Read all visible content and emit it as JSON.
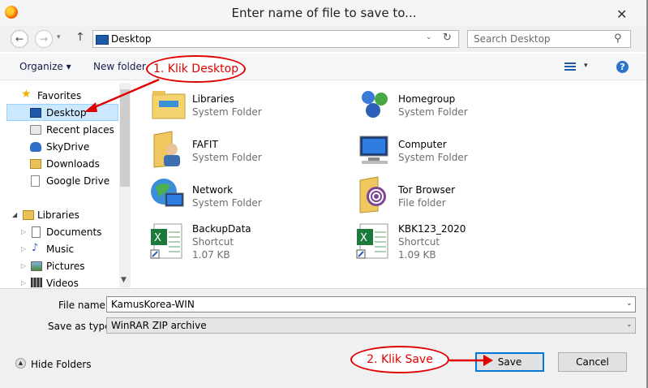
{
  "window": {
    "title": "Enter name of file to save to...",
    "close_glyph": "✕"
  },
  "nav": {
    "back_glyph": "←",
    "forward_glyph": "→",
    "up_glyph": "↑",
    "recent_glyph": "▾",
    "address": "Desktop",
    "address_dropdown_glyph": "⌄",
    "refresh_glyph": "↻",
    "search_placeholder": "Search Desktop",
    "search_glyph": "⚲"
  },
  "toolbar": {
    "organize": "Organize ▾",
    "new_folder": "New folder",
    "view_dropdown_glyph": "▾",
    "help_glyph": "?"
  },
  "sidebar": {
    "favorites": "Favorites",
    "favorites_items": [
      "Desktop",
      "Recent places",
      "SkyDrive",
      "Downloads",
      "Google Drive"
    ],
    "libraries": "Libraries",
    "libraries_items": [
      "Documents",
      "Music",
      "Pictures",
      "Videos"
    ],
    "scroll_down_glyph": "▼"
  },
  "files": [
    {
      "name": "Libraries",
      "sub1": "System Folder",
      "sub2": ""
    },
    {
      "name": "Homegroup",
      "sub1": "System Folder",
      "sub2": ""
    },
    {
      "name": "FAFIT",
      "sub1": "System Folder",
      "sub2": ""
    },
    {
      "name": "Computer",
      "sub1": "System Folder",
      "sub2": ""
    },
    {
      "name": "Network",
      "sub1": "System Folder",
      "sub2": ""
    },
    {
      "name": "Tor Browser",
      "sub1": "File folder",
      "sub2": ""
    },
    {
      "name": "BackupData",
      "sub1": "Shortcut",
      "sub2": "1.07 KB"
    },
    {
      "name": "KBK123_2020",
      "sub1": "Shortcut",
      "sub2": "1.09 KB"
    }
  ],
  "form": {
    "file_name_label": "File name:",
    "file_name_value": "KamusKorea-WIN",
    "save_type_label": "Save as type:",
    "save_type_value": "WinRAR ZIP archive",
    "dropdown_glyph": "⌄"
  },
  "footer": {
    "hide_folders": "Hide Folders",
    "hide_glyph": "▲",
    "save": "Save",
    "cancel": "Cancel"
  },
  "annotations": {
    "step1": "1. Klik Desktop",
    "step2": "2. Klik Save",
    "color": "#e10000"
  }
}
